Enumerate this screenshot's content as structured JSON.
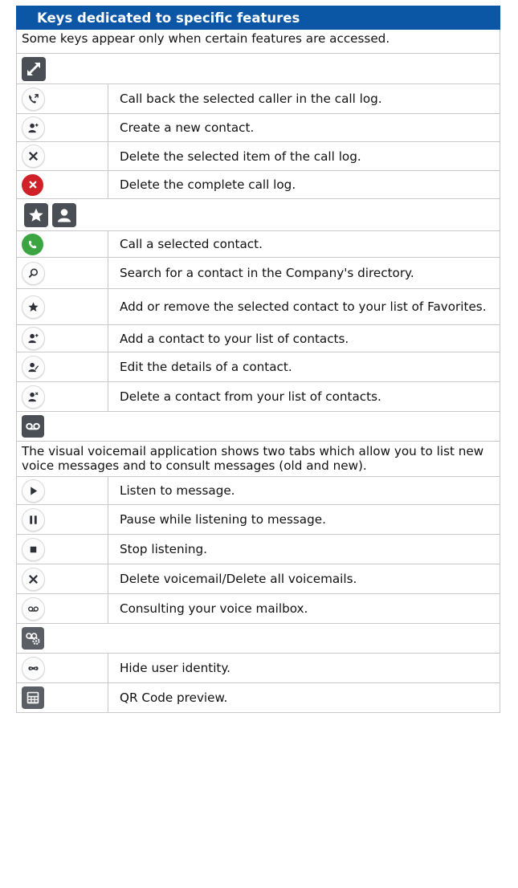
{
  "title": "Keys dedicated to specific features",
  "intro": "Some keys appear only when certain features are accessed.",
  "calllog": {
    "rows": [
      {
        "icon": "call-back-icon",
        "text": "Call back the selected caller in the call log."
      },
      {
        "icon": "add-contact-icon",
        "text": "Create a new contact."
      },
      {
        "icon": "delete-icon",
        "text": "Delete the selected item of the call log."
      },
      {
        "icon": "delete-all-icon",
        "text": "Delete the complete call log."
      }
    ]
  },
  "contacts": {
    "rows": [
      {
        "icon": "call-icon",
        "text": "Call a selected contact."
      },
      {
        "icon": "search-icon",
        "text": "Search for a contact in the Company's directory."
      },
      {
        "icon": "favorite-star-icon",
        "text": "Add or remove the selected contact to your list of Favorites."
      },
      {
        "icon": "add-contact-icon",
        "text": "Add a contact to your list of contacts."
      },
      {
        "icon": "edit-contact-icon",
        "text": "Edit the details of a contact."
      },
      {
        "icon": "delete-contact-icon",
        "text": "Delete a contact from your list of contacts."
      }
    ]
  },
  "voicemail": {
    "description": "The visual voicemail application shows two tabs which allow you to list new voice messages and to consult messages (old and new).",
    "rows": [
      {
        "icon": "play-icon",
        "text": "Listen to message."
      },
      {
        "icon": "pause-icon",
        "text": "Pause while listening to message."
      },
      {
        "icon": "stop-icon",
        "text": "Stop listening."
      },
      {
        "icon": "delete-icon",
        "text": "Delete voicemail/Delete all voicemails."
      },
      {
        "icon": "voicemail-icon",
        "text": "Consulting your voice mailbox."
      }
    ]
  },
  "settings": {
    "rows": [
      {
        "icon": "hide-identity-icon",
        "text": "Hide user identity."
      },
      {
        "icon": "qr-code-icon",
        "text": "QR Code preview."
      }
    ]
  },
  "colors": {
    "header": "#0c56a6",
    "border": "#c8c8c8",
    "icon_dark": "#4a4f56",
    "call_green": "#3aa541",
    "delete_red": "#cf2127"
  }
}
